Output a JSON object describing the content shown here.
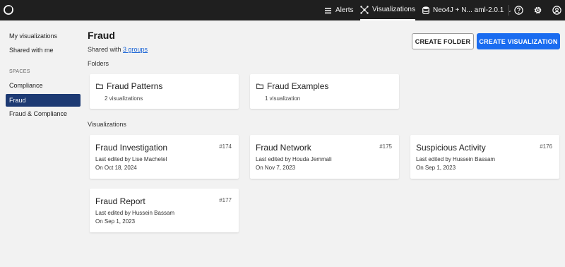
{
  "topbar": {
    "alerts_label": "Alerts",
    "visualizations_label": "Visualizations",
    "db_label": "Neo4J + N... aml-2.0.1",
    "chevron": "⌄"
  },
  "sidebar": {
    "my_visualizations": "My visualizations",
    "shared_with_me": "Shared with me",
    "spaces_heading": "SPACES",
    "spaces": [
      "Compliance",
      "Fraud",
      "Fraud & Compliance"
    ]
  },
  "page": {
    "title": "Fraud",
    "shared_prefix": "Shared with ",
    "shared_link": "3 groups",
    "create_folder": "CREATE FOLDER",
    "create_visualization": "CREATE VISUALIZATION",
    "folders_label": "Folders",
    "visualizations_label": "Visualizations"
  },
  "folders": [
    {
      "name": "Fraud Patterns",
      "count": "2 visualizations"
    },
    {
      "name": "Fraud Examples",
      "count": "1 visualization"
    }
  ],
  "visualizations": [
    {
      "name": "Fraud Investigation",
      "id": "#174",
      "edited_by": "Last edited by Lise Machetel",
      "date": "On Oct 18, 2024"
    },
    {
      "name": "Fraud Network",
      "id": "#175",
      "edited_by": "Last edited by Houda Jemmali",
      "date": "On Nov 7, 2023"
    },
    {
      "name": "Suspicious Activity",
      "id": "#176",
      "edited_by": "Last edited by Hussein Bassam",
      "date": "On Sep 1, 2023"
    },
    {
      "name": "Fraud Report",
      "id": "#177",
      "edited_by": "Last edited by Hussein Bassam",
      "date": "On Sep 1, 2023"
    }
  ],
  "colors": {
    "topbar_bg": "#1f1f1f",
    "active_space": "#1d3a73",
    "primary_button": "#1a6cf0",
    "link": "#1a64d6"
  },
  "icons": [
    "app-logo-icon",
    "bell-list-icon",
    "graph-icon",
    "database-icon",
    "help-icon",
    "gear-icon",
    "user-icon",
    "folder-icon"
  ]
}
